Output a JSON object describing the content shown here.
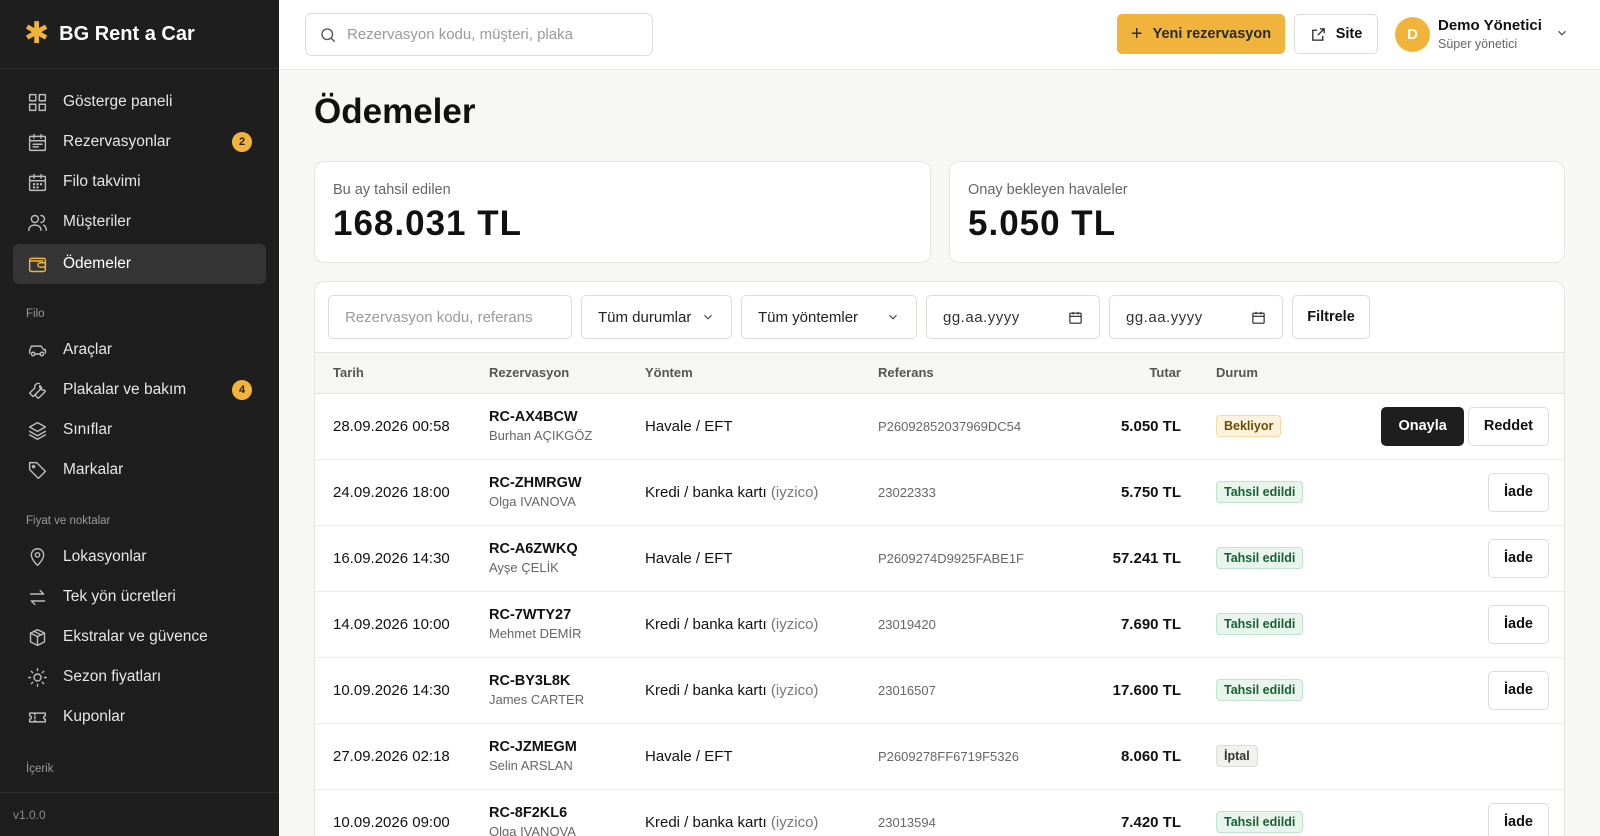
{
  "brand": {
    "name": "BG Rent a Car",
    "accent": "#f0b43c"
  },
  "sidebar": {
    "items": [
      {
        "label": "Gösterge paneli",
        "icon": "dashboard-icon"
      },
      {
        "label": "Rezervasyonlar",
        "icon": "calendar-icon",
        "badge": "2"
      },
      {
        "label": "Filo takvimi",
        "icon": "calendar-grid-icon"
      },
      {
        "label": "Müşteriler",
        "icon": "users-icon"
      },
      {
        "label": "Ödemeler",
        "icon": "wallet-icon",
        "active": true
      }
    ],
    "section_fleet": "Filo",
    "fleet_items": [
      {
        "label": "Araçlar",
        "icon": "car-icon"
      },
      {
        "label": "Plakalar ve bakım",
        "icon": "wrench-icon",
        "badge": "4"
      },
      {
        "label": "Sınıflar",
        "icon": "layers-icon"
      },
      {
        "label": "Markalar",
        "icon": "tag-icon"
      }
    ],
    "section_pricing": "Fiyat ve noktalar",
    "pricing_items": [
      {
        "label": "Lokasyonlar",
        "icon": "map-pin-icon"
      },
      {
        "label": "Tek yön ücretleri",
        "icon": "arrows-icon"
      },
      {
        "label": "Ekstralar ve güvence",
        "icon": "box-icon"
      },
      {
        "label": "Sezon fiyatları",
        "icon": "sun-icon"
      },
      {
        "label": "Kuponlar",
        "icon": "ticket-icon"
      }
    ],
    "section_content": "İçerik",
    "version": "v1.0.0"
  },
  "topbar": {
    "search_placeholder": "Rezervasyon kodu, müşteri, plaka",
    "new_button": "Yeni rezervasyon",
    "site_button": "Site",
    "user_initial": "D",
    "user_name": "Demo Yönetici",
    "user_role": "Süper yönetici"
  },
  "page": {
    "title": "Ödemeler"
  },
  "stats": [
    {
      "label": "Bu ay tahsil edilen",
      "value": "168.031 TL"
    },
    {
      "label": "Onay bekleyen havaleler",
      "value": "5.050 TL"
    }
  ],
  "filters": {
    "search_placeholder": "Rezervasyon kodu, referans",
    "status": "Tüm durumlar",
    "method": "Tüm yöntemler",
    "date_from": "gg.aa.yyyy",
    "date_to": "gg.aa.yyyy",
    "submit": "Filtrele"
  },
  "table": {
    "headers": [
      "Tarih",
      "Rezervasyon",
      "Yöntem",
      "Referans",
      "Tutar",
      "Durum"
    ],
    "rows": [
      {
        "date": "28.09.2026 00:58",
        "code": "RC-AX4BCW",
        "customer": "Burhan AÇIKGÖZ",
        "method": "Havale / EFT",
        "method_note": "",
        "ref": "P26092852037969DC54",
        "amount": "5.050 TL",
        "status": "Bekliyor",
        "status_kind": "wait",
        "actions": [
          "Onayla",
          "Reddet"
        ]
      },
      {
        "date": "24.09.2026 18:00",
        "code": "RC-ZHMRGW",
        "customer": "Olga IVANOVA",
        "method": "Kredi / banka kartı",
        "method_note": "(iyzico)",
        "ref": "23022333",
        "amount": "5.750 TL",
        "status": "Tahsil edildi",
        "status_kind": "ok",
        "actions": [
          "İade"
        ]
      },
      {
        "date": "16.09.2026 14:30",
        "code": "RC-A6ZWKQ",
        "customer": "Ayşe ÇELİK",
        "method": "Havale / EFT",
        "method_note": "",
        "ref": "P2609274D9925FABE1F",
        "amount": "57.241 TL",
        "status": "Tahsil edildi",
        "status_kind": "ok",
        "actions": [
          "İade"
        ]
      },
      {
        "date": "14.09.2026 10:00",
        "code": "RC-7WTY27",
        "customer": "Mehmet DEMİR",
        "method": "Kredi / banka kartı",
        "method_note": "(iyzico)",
        "ref": "23019420",
        "amount": "7.690 TL",
        "status": "Tahsil edildi",
        "status_kind": "ok",
        "actions": [
          "İade"
        ]
      },
      {
        "date": "10.09.2026 14:30",
        "code": "RC-BY3L8K",
        "customer": "James CARTER",
        "method": "Kredi / banka kartı",
        "method_note": "(iyzico)",
        "ref": "23016507",
        "amount": "17.600 TL",
        "status": "Tahsil edildi",
        "status_kind": "ok",
        "actions": [
          "İade"
        ]
      },
      {
        "date": "27.09.2026 02:18",
        "code": "RC-JZMEGM",
        "customer": "Selin ARSLAN",
        "method": "Havale / EFT",
        "method_note": "",
        "ref": "P2609278FF6719F5326",
        "amount": "8.060 TL",
        "status": "İptal",
        "status_kind": "cancel",
        "actions": []
      },
      {
        "date": "10.09.2026 09:00",
        "code": "RC-8F2KL6",
        "customer": "Olga IVANOVA",
        "method": "Kredi / banka kartı",
        "method_note": "(iyzico)",
        "ref": "23013594",
        "amount": "7.420 TL",
        "status": "Tahsil edildi",
        "status_kind": "ok",
        "actions": [
          "İade"
        ]
      }
    ]
  }
}
